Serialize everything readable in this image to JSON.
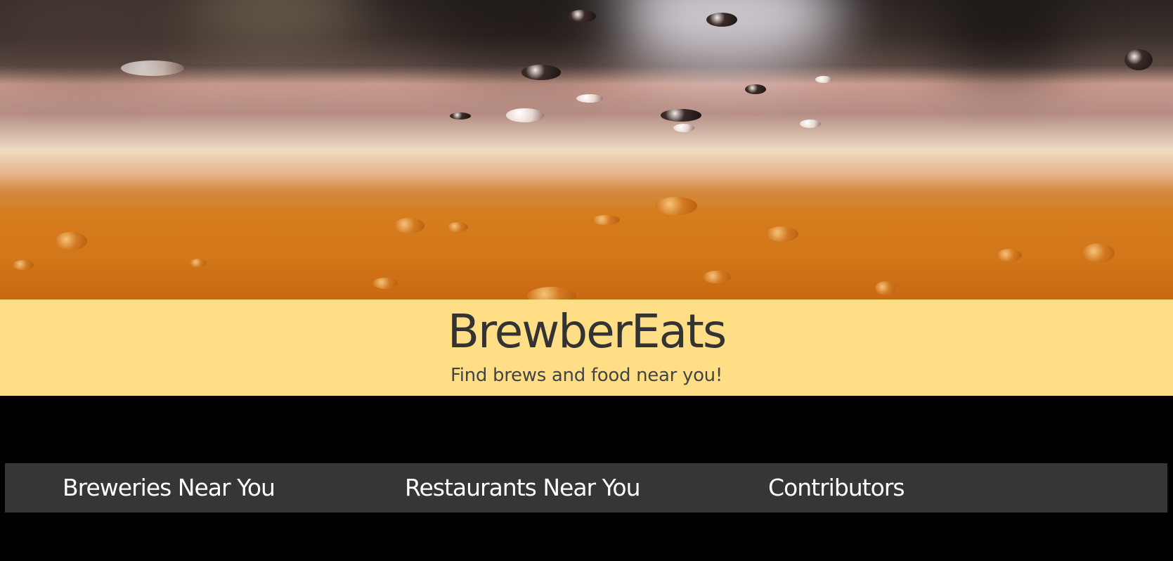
{
  "header": {
    "title": "BrewberEats",
    "tagline": "Find brews and food near you!"
  },
  "nav": {
    "items": [
      {
        "label": "Breweries Near You"
      },
      {
        "label": "Restaurants Near You"
      },
      {
        "label": "Contributors"
      }
    ]
  },
  "colors": {
    "title_band": "#ffde85",
    "nav_bar": "#363636",
    "page_background": "#000000",
    "text_dark": "#333333",
    "nav_text": "#ffffff"
  }
}
